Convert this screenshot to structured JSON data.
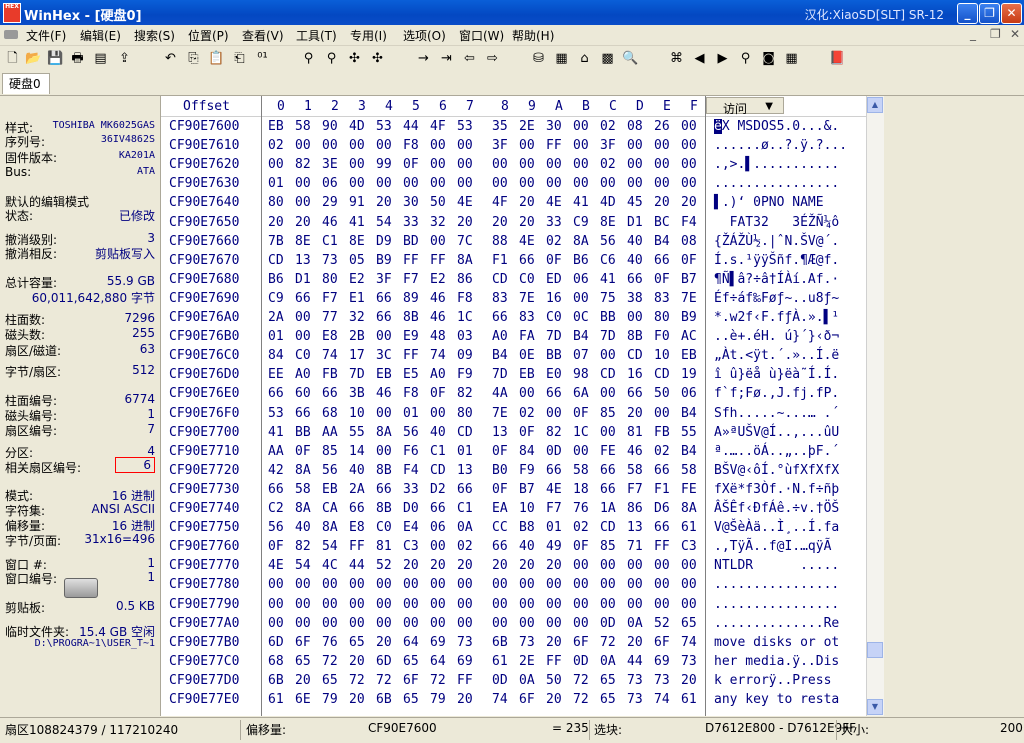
{
  "window": {
    "title": "WinHex - [硬盘0]",
    "credit": "汉化:XiaoSD[SLT] SR-12",
    "logo": "HEX"
  },
  "menu": [
    "文件(F)",
    "编辑(E)",
    "搜索(S)",
    "位置(P)",
    "查看(V)",
    "工具(T)",
    "专用(I)",
    "选项(O)",
    "窗口(W)",
    "帮助(H)"
  ],
  "tabs": [
    {
      "label": "硬盘0"
    }
  ],
  "left_panel": {
    "groups": [
      [
        {
          "k": "样式:",
          "v": "TOSHIBA MK6025GAS",
          "sm": true
        },
        {
          "k": "序列号:",
          "v": "36IV4862S",
          "sm": true
        },
        {
          "k": "固件版本:",
          "v": "KA201A",
          "sm": true
        },
        {
          "k": "Bus:",
          "v": "ATA",
          "sm": true
        }
      ],
      [
        {
          "k": "默认的编辑模式",
          "v": ""
        },
        {
          "k": "状态:",
          "v": "已修改"
        }
      ],
      [
        {
          "k": "撤消级别:",
          "v": "3"
        },
        {
          "k": "撤消相反:",
          "v": "剪贴板写入"
        }
      ],
      [
        {
          "k": "总计容量:",
          "v": "55.9 GB"
        },
        {
          "k": "",
          "v": "60,011,642,880 字节"
        }
      ],
      [
        {
          "k": "柱面数:",
          "v": "7296"
        },
        {
          "k": "磁头数:",
          "v": "255"
        },
        {
          "k": "扇区/磁道:",
          "v": "63"
        }
      ],
      [
        {
          "k": "字节/扇区:",
          "v": "512"
        }
      ],
      [
        {
          "k": "柱面编号:",
          "v": "6774"
        },
        {
          "k": "磁头编号:",
          "v": "1"
        },
        {
          "k": "扇区编号:",
          "v": "7"
        }
      ],
      [
        {
          "k": "分区:",
          "v": "4"
        },
        {
          "k": "相关扇区编号:",
          "v": "6",
          "hl": true
        }
      ],
      [
        {
          "k": "模式:",
          "v": "16 进制"
        },
        {
          "k": "字符集:",
          "v": "ANSI ASCII"
        },
        {
          "k": "偏移量:",
          "v": "16 进制"
        },
        {
          "k": "字节/页面:",
          "v": "31x16=496"
        }
      ],
      [
        {
          "k": "窗口 #:",
          "v": "1"
        },
        {
          "k": "窗口编号:",
          "v": "1"
        }
      ],
      [
        {
          "k": "剪贴板:",
          "v": "0.5 KB"
        }
      ],
      [
        {
          "k": "临时文件夹:",
          "v": "15.4 GB 空闲"
        },
        {
          "k": "",
          "v": "D:\\PROGRA~1\\USER_T~1",
          "sm": true
        }
      ]
    ]
  },
  "hex": {
    "offset_header": "Offset",
    "columns": [
      "0",
      "1",
      "2",
      "3",
      "4",
      "5",
      "6",
      "7",
      "8",
      "9",
      "A",
      "B",
      "C",
      "D",
      "E",
      "F"
    ],
    "access_label": "访问",
    "rows": [
      {
        "o": "CF90E7600",
        "b": "EB 58 90 4D 53 44 4F 53 35 2E 30 00 02 08 26 00",
        "a": "ëX MSDOS5.0...&."
      },
      {
        "o": "CF90E7610",
        "b": "02 00 00 00 00 F8 00 00 3F 00 FF 00 3F 00 00 00",
        "a": "......ø..?.ÿ.?..."
      },
      {
        "o": "CF90E7620",
        "b": "00 82 3E 00 99 0F 00 00 00 00 00 00 02 00 00 00",
        "a": ".‚>.▌..........."
      },
      {
        "o": "CF90E7630",
        "b": "01 00 06 00 00 00 00 00 00 00 00 00 00 00 00 00",
        "a": "................"
      },
      {
        "o": "CF90E7640",
        "b": "80 00 29 91 20 30 50 4E 4F 20 4E 41 4D 45 20 20",
        "a": "▌.)‘ 0PNO NAME  "
      },
      {
        "o": "CF90E7650",
        "b": "20 20 46 41 54 33 32 20 20 20 33 C9 8E D1 BC F4",
        "a": "  FAT32   3ÉŽÑ¼ô"
      },
      {
        "o": "CF90E7660",
        "b": "7B 8E C1 8E D9 BD 00 7C 88 4E 02 8A 56 40 B4 08",
        "a": "{ŽÁŽÙ½.|ˆN.ŠV@´."
      },
      {
        "o": "CF90E7670",
        "b": "CD 13 73 05 B9 FF FF 8A F1 66 0F B6 C6 40 66 0F",
        "a": "Í.s.¹ÿÿŠñf.¶Æ@f."
      },
      {
        "o": "CF90E7680",
        "b": "B6 D1 80 E2 3F F7 E2 86 CD C0 ED 06 41 66 0F B7",
        "a": "¶Ñ▌â?÷â†ÍÀí.Af.·"
      },
      {
        "o": "CF90E7690",
        "b": "C9 66 F7 E1 66 89 46 F8 83 7E 16 00 75 38 83 7E",
        "a": "Éf÷áf‰Føƒ~..u8ƒ~"
      },
      {
        "o": "CF90E76A0",
        "b": "2A 00 77 32 66 8B 46 1C 66 83 C0 0C BB 00 80 B9",
        "a": "*.w2f‹F.fƒÀ.».▌¹"
      },
      {
        "o": "CF90E76B0",
        "b": "01 00 E8 2B 00 E9 48 03 A0 FA 7D B4 7D 8B F0 AC",
        "a": "..è+.éH. ú}´}‹ð¬"
      },
      {
        "o": "CF90E76C0",
        "b": "84 C0 74 17 3C FF 74 09 B4 0E BB 07 00 CD 10 EB",
        "a": "„Àt.<ÿt.´.»..Í.ë"
      },
      {
        "o": "CF90E76D0",
        "b": "EE A0 FB 7D EB E5 A0 F9 7D EB E0 98 CD 16 CD 19",
        "a": "î û}ëå ù}ëà˜Í.Í."
      },
      {
        "o": "CF90E76E0",
        "b": "66 60 66 3B 46 F8 0F 82 4A 00 66 6A 00 66 50 06",
        "a": "f`f;Fø.‚J.fj.fP."
      },
      {
        "o": "CF90E76F0",
        "b": "53 66 68 10 00 01 00 80 7E 02 00 0F 85 20 00 B4",
        "a": "Sfh.....~...… .´"
      },
      {
        "o": "CF90E7700",
        "b": "41 BB AA 55 8A 56 40 CD 13 0F 82 1C 00 81 FB 55",
        "a": "A»ªUŠV@Í..‚...ûU"
      },
      {
        "o": "CF90E7710",
        "b": "AA 0F 85 14 00 F6 C1 01 0F 84 0D 00 FE 46 02 B4",
        "a": "ª.…..öÁ..„..þF.´"
      },
      {
        "o": "CF90E7720",
        "b": "42 8A 56 40 8B F4 CD 13 B0 F9 66 58 66 58 66 58",
        "a": "BŠV@‹ôÍ.°ùfXfXfX"
      },
      {
        "o": "CF90E7730",
        "b": "66 58 EB 2A 66 33 D2 66 0F B7 4E 18 66 F7 F1 FE",
        "a": "fXë*f3Òf.·N.f÷ñþ"
      },
      {
        "o": "CF90E7740",
        "b": "C2 8A CA 66 8B D0 66 C1 EA 10 F7 76 1A 86 D6 8A",
        "a": "ÂŠÊf‹ÐfÁê.÷v.†ÖŠ"
      },
      {
        "o": "CF90E7750",
        "b": "56 40 8A E8 C0 E4 06 0A CC B8 01 02 CD 13 66 61",
        "a": "V@ŠèÀä..Ì¸..Í.fa"
      },
      {
        "o": "CF90E7760",
        "b": "0F 82 54 FF 81 C3 00 02 66 40 49 0F 85 71 FF C3",
        "a": ".‚TÿÃ..f@I.…qÿÃ"
      },
      {
        "o": "CF90E7770",
        "b": "4E 54 4C 44 52 20 20 20 20 20 20 00 00 00 00 00",
        "a": "NTLDR      ....."
      },
      {
        "o": "CF90E7780",
        "b": "00 00 00 00 00 00 00 00 00 00 00 00 00 00 00 00",
        "a": "................"
      },
      {
        "o": "CF90E7790",
        "b": "00 00 00 00 00 00 00 00 00 00 00 00 00 00 00 00",
        "a": "................"
      },
      {
        "o": "CF90E77A0",
        "b": "00 00 00 00 00 00 00 00 00 00 00 00 0D 0A 52 65",
        "a": "..............Re"
      },
      {
        "o": "CF90E77B0",
        "b": "6D 6F 76 65 20 64 69 73 6B 73 20 6F 72 20 6F 74",
        "a": "move disks or ot"
      },
      {
        "o": "CF90E77C0",
        "b": "68 65 72 20 6D 65 64 69 61 2E FF 0D 0A 44 69 73",
        "a": "her media.ÿ..Dis"
      },
      {
        "o": "CF90E77D0",
        "b": "6B 20 65 72 72 6F 72 FF 0D 0A 50 72 65 73 73 20",
        "a": "k errorÿ..Press "
      },
      {
        "o": "CF90E77E0",
        "b": "61 6E 79 20 6B 65 79 20 74 6F 20 72 65 73 74 61",
        "a": "any key to resta"
      }
    ]
  },
  "status": {
    "sector": "扇区108824379 / 117210240",
    "offset_label": "偏移量:",
    "offset_value": "CF90E7600",
    "eq_value": "= 235",
    "sel_label": "选块:",
    "sel_value": "D7612E800 - D7612E9FF",
    "size_label": "大小:",
    "size_value": "200"
  }
}
